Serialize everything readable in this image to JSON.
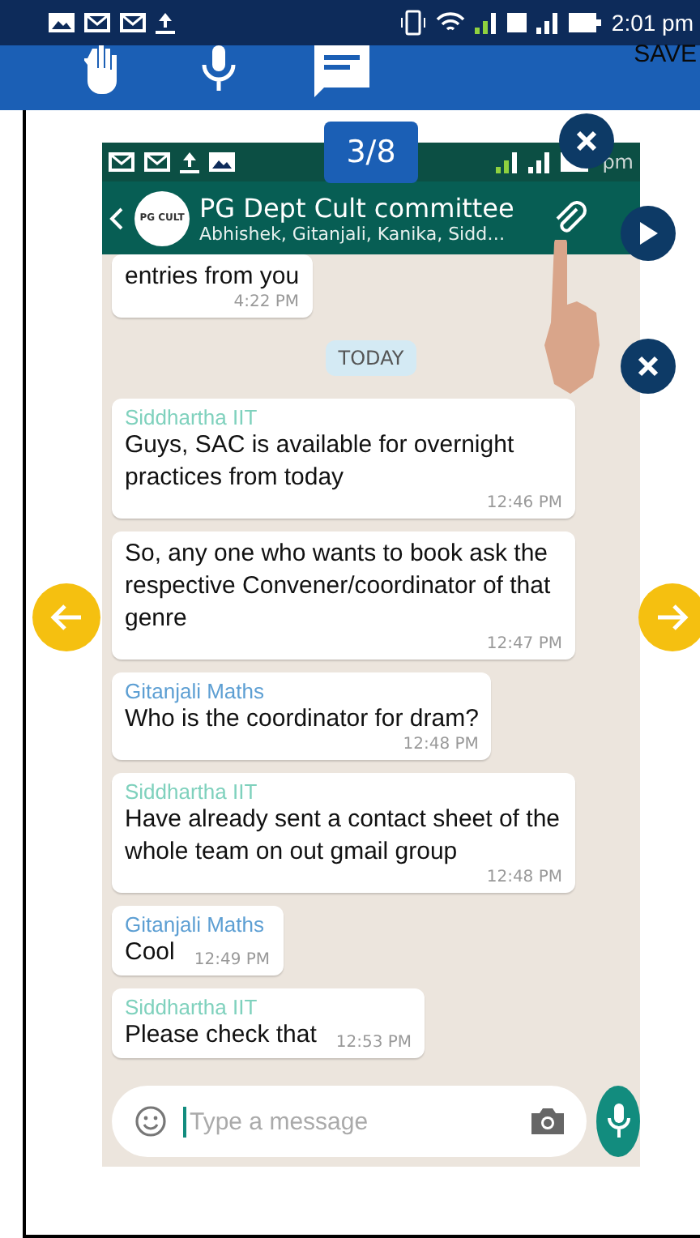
{
  "status_bar": {
    "time": "2:01 pm"
  },
  "toolbar": {
    "save": "SAVE"
  },
  "counter": "3/8",
  "screenshot": {
    "status_time": "pm",
    "chat_title": "PG Dept Cult committee",
    "chat_members": "Abhishek, Gitanjali, Kanika, Sidd…",
    "avatar_text": "PG CULT",
    "items": [
      {
        "kind": "message",
        "text": "entries from you",
        "time": "4:22 PM"
      },
      {
        "kind": "date",
        "text": "TODAY"
      },
      {
        "kind": "message",
        "sender": "Siddhartha IIT",
        "color": "#7fd1bd",
        "text": "Guys, SAC is available for overnight practices from today",
        "time": "12:46 PM"
      },
      {
        "kind": "message",
        "text": "So, any one who wants to book ask the respective Convener/coordinator of that genre",
        "time": "12:47 PM"
      },
      {
        "kind": "message",
        "sender": "Gitanjali Maths",
        "color": "#5d9fd3",
        "text": "Who is the coordinator for dram?",
        "time": "12:48 PM"
      },
      {
        "kind": "message",
        "sender": "Siddhartha IIT",
        "color": "#7fd1bd",
        "text": "Have already sent a contact sheet of the whole team on out gmail group",
        "time": "12:48 PM"
      },
      {
        "kind": "short_message",
        "sender": "Gitanjali Maths",
        "color": "#5d9fd3",
        "text": "Cool",
        "time": "12:49 PM"
      },
      {
        "kind": "short_message",
        "sender": "Siddhartha IIT",
        "color": "#7fd1bd",
        "text": "Please check that",
        "time": "12:53 PM"
      }
    ],
    "input_placeholder": "Type a message"
  }
}
